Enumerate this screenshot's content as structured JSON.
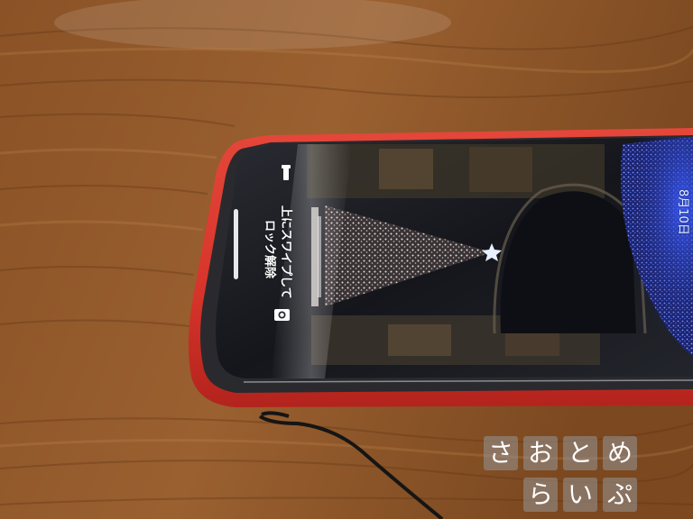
{
  "lock_screen": {
    "swipe_hint_line1": "上にスワイプして",
    "swipe_hint_line2": "ロック解除",
    "date": "8月10日"
  },
  "watermark": {
    "row1": [
      "さ",
      "お",
      "と",
      "め"
    ],
    "row2": [
      "ら",
      "い",
      "ぷ"
    ]
  },
  "colors": {
    "table_wood": "#8a5428",
    "phone_case": "#d8362e",
    "screen_dark": "#1a1b20",
    "tree_lights": "#cfc8c4"
  },
  "icons": [
    "flashlight-icon",
    "camera-icon",
    "star-icon"
  ]
}
